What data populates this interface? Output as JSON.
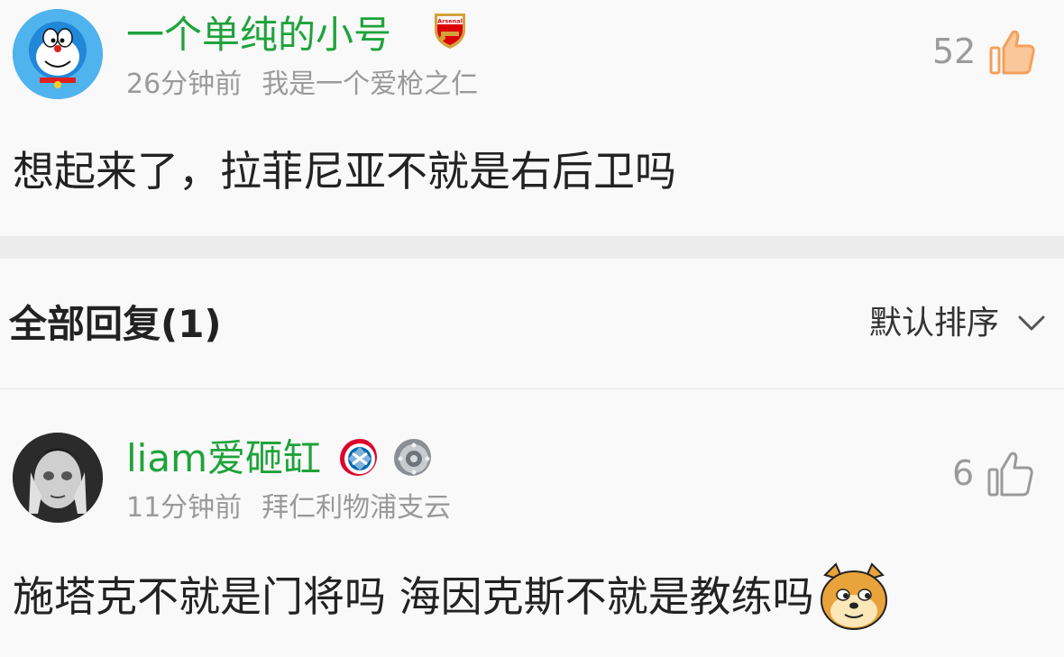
{
  "comment": {
    "username": "一个单纯的小号",
    "time": "26分钟前",
    "signature": "我是一个爱枪之仁",
    "likes": "52",
    "text": "想起来了，拉菲尼亚不就是右后卫吗",
    "avatar_icon": "doraemon-avatar",
    "badge_icon": "arsenal-badge-icon",
    "badge_text": "Arsenal"
  },
  "replies_section": {
    "title": "全部回复(1)",
    "sort_label": "默认排序"
  },
  "reply": {
    "username": "liam爱砸缸",
    "time": "11分钟前",
    "signature": "拜仁利物浦支云",
    "likes": "6",
    "text": "施塔克不就是门将吗 海因克斯不就是教练吗",
    "avatar_icon": "bw-photo-avatar",
    "badge_icons": [
      "bayern-badge-icon",
      "bundesliga-trophy-icon"
    ],
    "emoji_icon": "doge-emoji-icon"
  },
  "colors": {
    "username_green": "#1ea33a",
    "like_orange": "#f5a05a",
    "gray_text": "#9a9a9a"
  }
}
